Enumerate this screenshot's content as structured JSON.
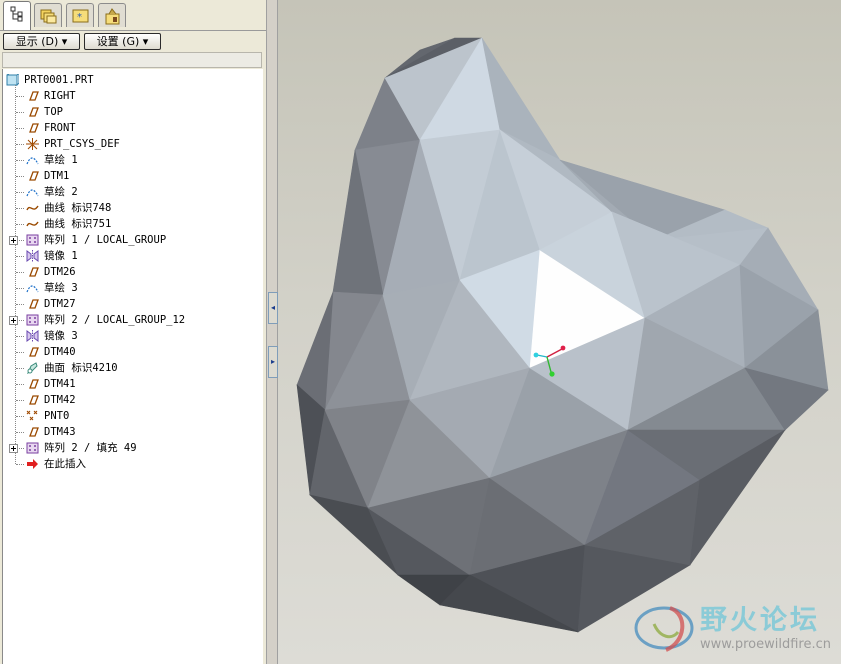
{
  "toolbar": {
    "show_label": "显示 (D) ▾",
    "settings_label": "设置 (G) ▾"
  },
  "tree": {
    "root": "PRT0001.PRT",
    "items": [
      {
        "label": "RIGHT",
        "icon": "datum-plane-icon"
      },
      {
        "label": "TOP",
        "icon": "datum-plane-icon"
      },
      {
        "label": "FRONT",
        "icon": "datum-plane-icon"
      },
      {
        "label": "PRT_CSYS_DEF",
        "icon": "coordinate-system-icon"
      },
      {
        "label": "草绘 1",
        "icon": "sketch-icon"
      },
      {
        "label": "DTM1",
        "icon": "datum-plane-icon"
      },
      {
        "label": "草绘 2",
        "icon": "sketch-icon"
      },
      {
        "label": "曲线 标识748",
        "icon": "curve-icon"
      },
      {
        "label": "曲线 标识751",
        "icon": "curve-icon"
      },
      {
        "label": "阵列 1 / LOCAL_GROUP",
        "icon": "pattern-icon",
        "expandable": true
      },
      {
        "label": "镜像 1",
        "icon": "mirror-icon"
      },
      {
        "label": "DTM26",
        "icon": "datum-plane-icon"
      },
      {
        "label": "草绘 3",
        "icon": "sketch-icon"
      },
      {
        "label": "DTM27",
        "icon": "datum-plane-icon"
      },
      {
        "label": "阵列 2 / LOCAL_GROUP_12",
        "icon": "pattern-icon",
        "expandable": true
      },
      {
        "label": "镜像 3",
        "icon": "mirror-icon"
      },
      {
        "label": "DTM40",
        "icon": "datum-plane-icon"
      },
      {
        "label": "曲面 标识4210",
        "icon": "surface-icon"
      },
      {
        "label": "DTM41",
        "icon": "datum-plane-icon"
      },
      {
        "label": "DTM42",
        "icon": "datum-plane-icon"
      },
      {
        "label": "PNT0",
        "icon": "datum-point-icon"
      },
      {
        "label": "DTM43",
        "icon": "datum-plane-icon"
      },
      {
        "label": "阵列 2 / 填充 49",
        "icon": "pattern-icon",
        "expandable": true
      },
      {
        "label": "在此插入",
        "icon": "insert-here-arrow-icon"
      }
    ]
  },
  "watermark": {
    "text": "野火论坛",
    "url": "www.proewildfire.cn"
  }
}
